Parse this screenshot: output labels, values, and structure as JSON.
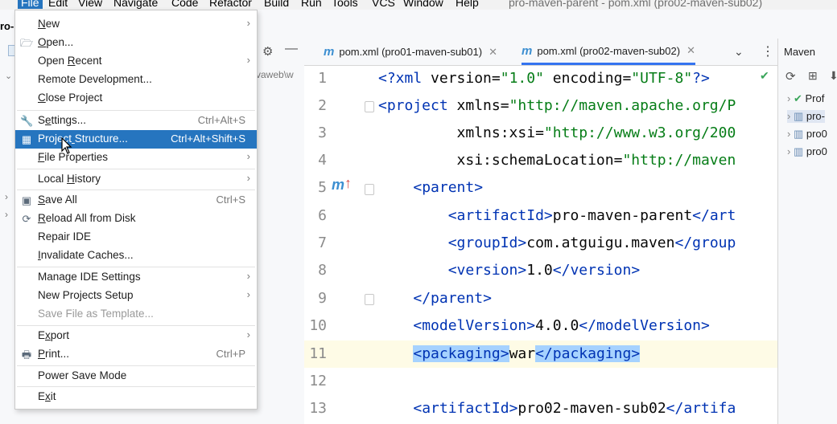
{
  "menubar": {
    "items": [
      "File",
      "Edit",
      "View",
      "Navigate",
      "Code",
      "Refactor",
      "Build",
      "Run",
      "Tools",
      "VCS",
      "Window",
      "Help"
    ],
    "window_title": "pro-maven-parent - pom.xml (pro02-maven-sub02)"
  },
  "project_panel": {
    "title_fragment": "ro-",
    "path_fragment": "vaweb\\w"
  },
  "file_menu": {
    "items": [
      {
        "label": "New",
        "shortcut": "",
        "submenu": true
      },
      {
        "label": "Open...",
        "shortcut": "",
        "submenu": false,
        "icon": "folder-open-icon"
      },
      {
        "label": "Open Recent",
        "shortcut": "",
        "submenu": true
      },
      {
        "label": "Remote Development...",
        "shortcut": "",
        "submenu": false
      },
      {
        "label": "Close Project",
        "shortcut": "",
        "submenu": false
      },
      {
        "label": "Settings...",
        "shortcut": "Ctrl+Alt+S",
        "submenu": false,
        "icon": "wrench-icon"
      },
      {
        "label": "Project Structure...",
        "shortcut": "Ctrl+Alt+Shift+S",
        "submenu": false,
        "icon": "project-structure-icon",
        "selected": true
      },
      {
        "label": "File Properties",
        "shortcut": "",
        "submenu": true
      },
      {
        "label": "Local History",
        "shortcut": "",
        "submenu": true
      },
      {
        "label": "Save All",
        "shortcut": "Ctrl+S",
        "submenu": false,
        "icon": "save-icon"
      },
      {
        "label": "Reload All from Disk",
        "shortcut": "",
        "submenu": false,
        "icon": "reload-icon"
      },
      {
        "label": "Repair IDE",
        "shortcut": "",
        "submenu": false
      },
      {
        "label": "Invalidate Caches...",
        "shortcut": "",
        "submenu": false
      },
      {
        "label": "Manage IDE Settings",
        "shortcut": "",
        "submenu": true
      },
      {
        "label": "New Projects Setup",
        "shortcut": "",
        "submenu": true
      },
      {
        "label": "Save File as Template...",
        "shortcut": "",
        "submenu": false,
        "disabled": true
      },
      {
        "label": "Export",
        "shortcut": "",
        "submenu": true
      },
      {
        "label": "Print...",
        "shortcut": "Ctrl+P",
        "submenu": false,
        "icon": "print-icon"
      },
      {
        "label": "Power Save Mode",
        "shortcut": "",
        "submenu": false
      },
      {
        "label": "Exit",
        "shortcut": "",
        "submenu": false
      }
    ]
  },
  "tabs": [
    {
      "label": "pom.xml (pro01-maven-sub01)",
      "active": false
    },
    {
      "label": "pom.xml (pro02-maven-sub02)",
      "active": true
    }
  ],
  "editor": {
    "line_numbers": [
      "1",
      "2",
      "3",
      "4",
      "5",
      "6",
      "7",
      "8",
      "9",
      "10",
      "11",
      "12",
      "13"
    ],
    "lines": [
      "<?xml version=\"1.0\" encoding=\"UTF-8\"?>",
      "<project xmlns=\"http://maven.apache.org/P",
      "         xmlns:xsi=\"http://www.w3.org/200",
      "         xsi:schemaLocation=\"http://maven",
      "    <parent>",
      "        <artifactId>pro-maven-parent</art",
      "        <groupId>com.atguigu.maven</group",
      "        <version>1.0</version>",
      "    </parent>",
      "    <modelVersion>4.0.0</modelVersion>",
      "    <packaging>war</packaging>",
      "",
      "    <artifactId>pro02-maven-sub02</artifa"
    ]
  },
  "maven_panel": {
    "title": "Maven",
    "items": [
      "Prof",
      "pro-",
      "pro0",
      "pro0"
    ]
  },
  "colors": {
    "selection": "#2675bf",
    "tab_underline": "#3574f0",
    "xml_tag": "#0033b3",
    "xml_value": "#067d17"
  }
}
